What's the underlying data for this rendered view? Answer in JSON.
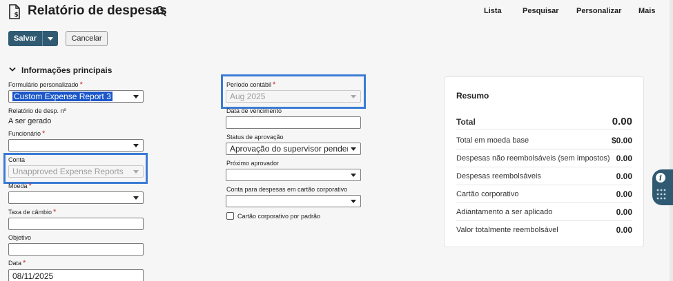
{
  "header": {
    "title": "Relatório de despesas",
    "nav": [
      "Lista",
      "Pesquisar",
      "Personalizar",
      "Mais"
    ]
  },
  "toolbar": {
    "save_label": "Salvar",
    "cancel_label": "Cancelar"
  },
  "section": {
    "title": "Informações principais"
  },
  "fields": {
    "custom_form": {
      "label": "Formulário personalizado",
      "value": "Custom Expense Report 3"
    },
    "report_no": {
      "label": "Relatório de desp. nº",
      "value": "A ser gerado"
    },
    "employee": {
      "label": "Funcionário",
      "value": ""
    },
    "account": {
      "label": "Conta",
      "value": "Unapproved Expense Reports"
    },
    "currency": {
      "label": "Moeda",
      "value": ""
    },
    "exchange_rate": {
      "label": "Taxa de câmbio",
      "value": ""
    },
    "purpose": {
      "label": "Objetivo",
      "value": ""
    },
    "date": {
      "label": "Data",
      "value": "08/11/2025"
    },
    "period": {
      "label": "Período contábil",
      "value": "Aug 2025"
    },
    "due_date": {
      "label": "Data de vencimento",
      "value": ""
    },
    "approval_status": {
      "label": "Status de aprovação",
      "value": "Aprovação do supervisor pendente"
    },
    "next_approver": {
      "label": "Próximo aprovador",
      "value": ""
    },
    "card_account": {
      "label": "Conta para despesas em cartão corporativo",
      "value": ""
    },
    "card_default": {
      "label": "Cartão corporativo por padrão",
      "checked": false
    }
  },
  "summary": {
    "title": "Resumo",
    "rows": [
      {
        "label": "Total",
        "value": "0.00"
      },
      {
        "label": "Total em moeda base",
        "value": "$0.00"
      },
      {
        "label": "Despesas não reembolsáveis (sem impostos)",
        "value": "0.00"
      },
      {
        "label": "Despesas reembolsáveis",
        "value": "0.00"
      },
      {
        "label": "Cartão corporativo",
        "value": "0.00"
      },
      {
        "label": "Adiantamento a ser aplicado",
        "value": "0.00"
      },
      {
        "label": "Valor totalmente reembolsável",
        "value": "0.00"
      }
    ]
  },
  "side_widget": {
    "icon": "info-icon"
  },
  "colors": {
    "primary": "#2f5a72",
    "required": "#c5242b",
    "focus": "#3a7bd5",
    "selection": "#1b57c9"
  }
}
